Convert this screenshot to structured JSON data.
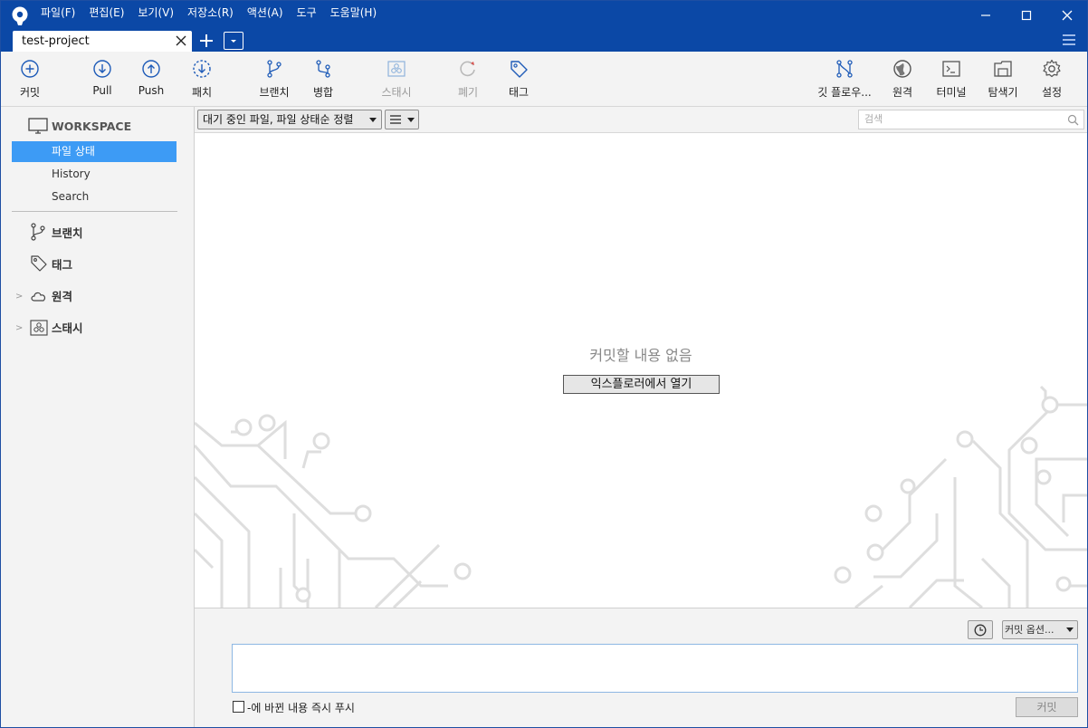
{
  "menu": [
    "파일(F)",
    "편집(E)",
    "보기(V)",
    "저장소(R)",
    "액션(A)",
    "도구",
    "도움말(H)"
  ],
  "tab": {
    "title": "test-project"
  },
  "toolbar": {
    "commit": "커밋",
    "pull": "Pull",
    "push": "Push",
    "patch": "패치",
    "branch": "브랜치",
    "merge": "병합",
    "stash": "스태시",
    "discard": "폐기",
    "tag": "태그",
    "gitflow": "깃 플로우...",
    "remote": "원격",
    "terminal": "터미널",
    "explorer": "탐색기",
    "settings": "설정"
  },
  "sidebar": {
    "workspace": "WORKSPACE",
    "file_status": "파일 상태",
    "history": "History",
    "search": "Search",
    "branches": "브랜치",
    "tags": "태그",
    "remotes": "원격",
    "stashes": "스태시"
  },
  "filter": {
    "sort": "대기 중인 파일, 파일 상태순 정렬",
    "search_placeholder": "검색"
  },
  "main": {
    "empty": "커밋할 내용 없음",
    "open_explorer": "익스플로러에서 열기"
  },
  "commit": {
    "options": "커밋 옵션...",
    "push_immediately": "-에 바뀐 내용 즉시 푸시",
    "button": "커밋"
  },
  "colors": {
    "titlebar": "#0b48a6",
    "selection": "#3d9bf5",
    "icon_blue": "#1e5bb8"
  }
}
